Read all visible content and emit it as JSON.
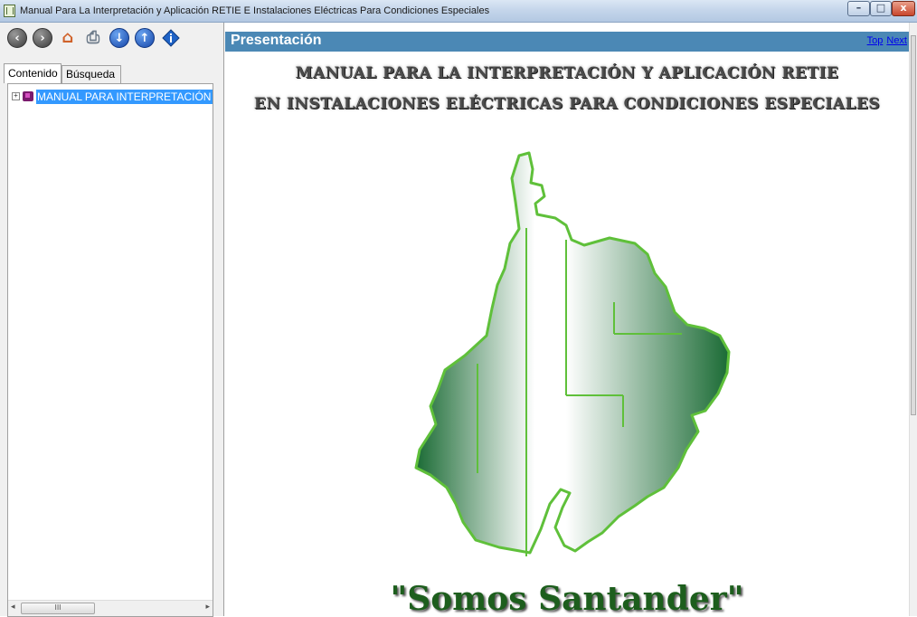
{
  "window": {
    "title": "Manual Para La Interpretación y Aplicación RETIE E Instalaciones Eléctricas Para Condiciones Especiales",
    "controls": {
      "minimize": "–",
      "maximize": "□",
      "close": "x"
    }
  },
  "toolbar": {
    "buttons": [
      {
        "icon": "back-arrow-icon",
        "glyph": "‹"
      },
      {
        "icon": "forward-arrow-icon",
        "glyph": "›"
      },
      {
        "icon": "home-icon",
        "glyph": "⌂"
      },
      {
        "icon": "print-icon",
        "glyph": "⎙"
      },
      {
        "icon": "down-arrow-icon",
        "glyph": "↓"
      },
      {
        "icon": "up-arrow-icon",
        "glyph": "↑"
      },
      {
        "icon": "options-icon",
        "glyph": "i"
      }
    ]
  },
  "left_pane": {
    "tabs": [
      {
        "label": "Contenido",
        "active": true
      },
      {
        "label": "Búsqueda",
        "active": false
      }
    ],
    "tree": [
      {
        "label": "MANUAL PARA INTERPRETACIÓN Y",
        "expander": "+",
        "selected": true
      }
    ],
    "scrollbar_grip": "III"
  },
  "content": {
    "header_title": "Presentación",
    "nav_links": [
      "Top",
      "Next"
    ],
    "heading_line1": "MANUAL PARA LA INTERPRETACIÓN Y APLICACIÓN RETIE",
    "heading_line2": "EN INSTALACIONES ELÉCTRICAS PARA CONDICIONES ESPECIALES",
    "slogan": "\"Somos Santander\""
  },
  "colors": {
    "header_bar": "#4b88b5",
    "selection": "#3399ff",
    "map_green": "#1b6b35",
    "map_outline": "#5fc03a"
  }
}
